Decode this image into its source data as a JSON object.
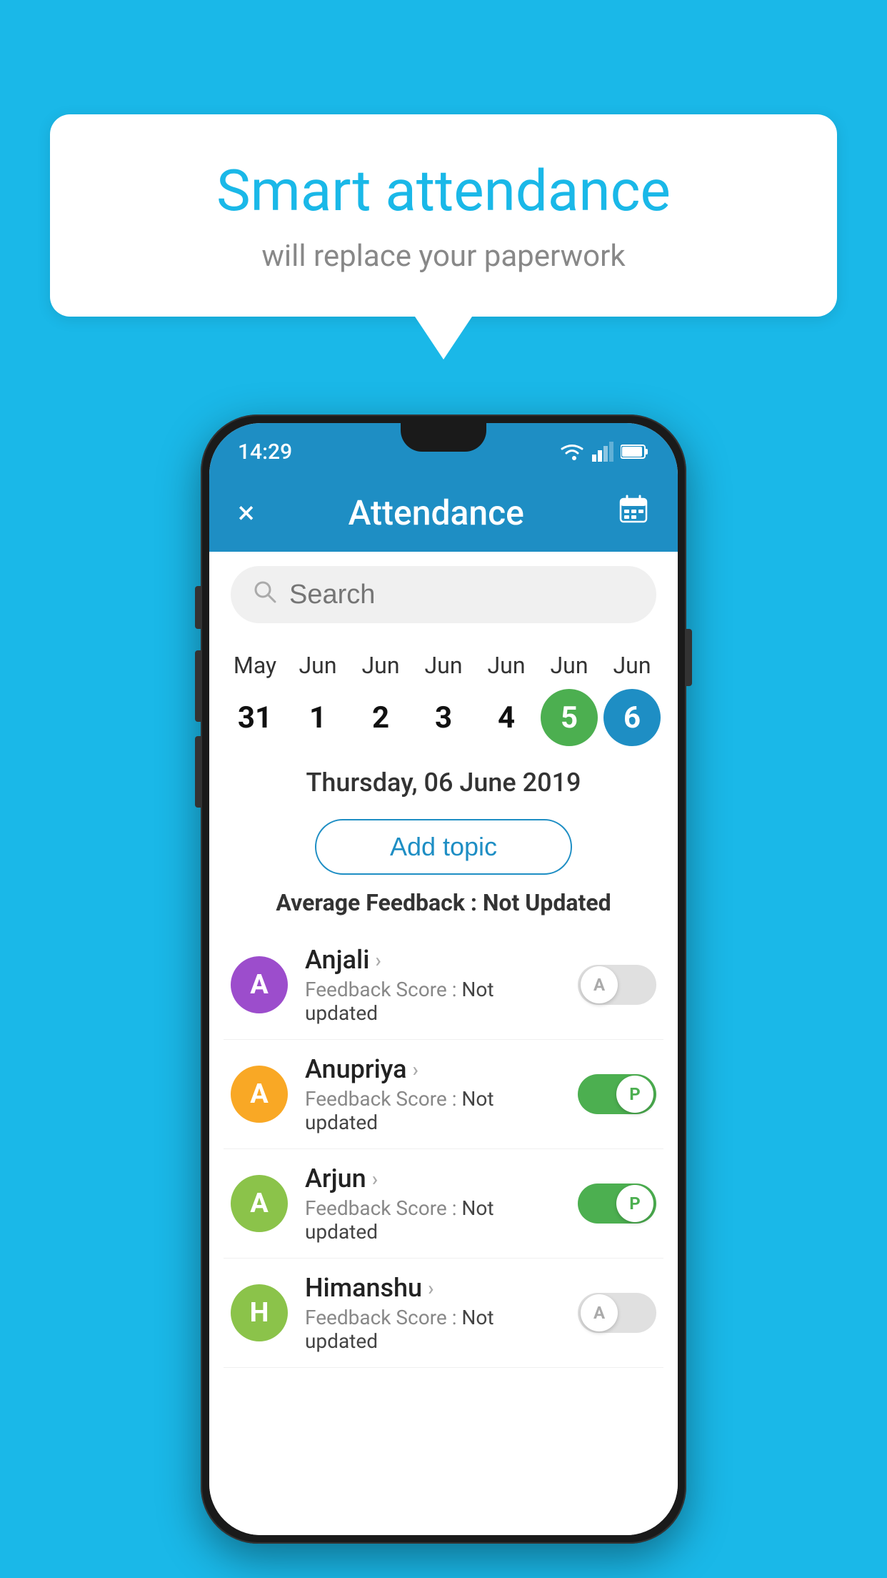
{
  "background_color": "#1ab8e8",
  "speech_bubble": {
    "title": "Smart attendance",
    "subtitle": "will replace your paperwork"
  },
  "status_bar": {
    "time": "14:29"
  },
  "app_bar": {
    "title": "Attendance",
    "close_label": "×",
    "calendar_label": "📅"
  },
  "search": {
    "placeholder": "Search"
  },
  "calendar": {
    "days": [
      {
        "month": "May",
        "date": "31",
        "state": "normal"
      },
      {
        "month": "Jun",
        "date": "1",
        "state": "normal"
      },
      {
        "month": "Jun",
        "date": "2",
        "state": "normal"
      },
      {
        "month": "Jun",
        "date": "3",
        "state": "normal"
      },
      {
        "month": "Jun",
        "date": "4",
        "state": "normal"
      },
      {
        "month": "Jun",
        "date": "5",
        "state": "today"
      },
      {
        "month": "Jun",
        "date": "6",
        "state": "selected"
      }
    ]
  },
  "selected_date": "Thursday, 06 June 2019",
  "add_topic_label": "Add topic",
  "avg_feedback_label": "Average Feedback :",
  "avg_feedback_value": "Not Updated",
  "students": [
    {
      "name": "Anjali",
      "initial": "A",
      "avatar_color": "#9c4dcc",
      "feedback": "Not updated",
      "toggle": "off",
      "toggle_label": "A"
    },
    {
      "name": "Anupriya",
      "initial": "A",
      "avatar_color": "#f9a825",
      "feedback": "Not updated",
      "toggle": "on",
      "toggle_label": "P"
    },
    {
      "name": "Arjun",
      "initial": "A",
      "avatar_color": "#8bc34a",
      "feedback": "Not updated",
      "toggle": "on",
      "toggle_label": "P"
    },
    {
      "name": "Himanshu",
      "initial": "H",
      "avatar_color": "#8bc34a",
      "feedback": "Not updated",
      "toggle": "off",
      "toggle_label": "A"
    }
  ]
}
